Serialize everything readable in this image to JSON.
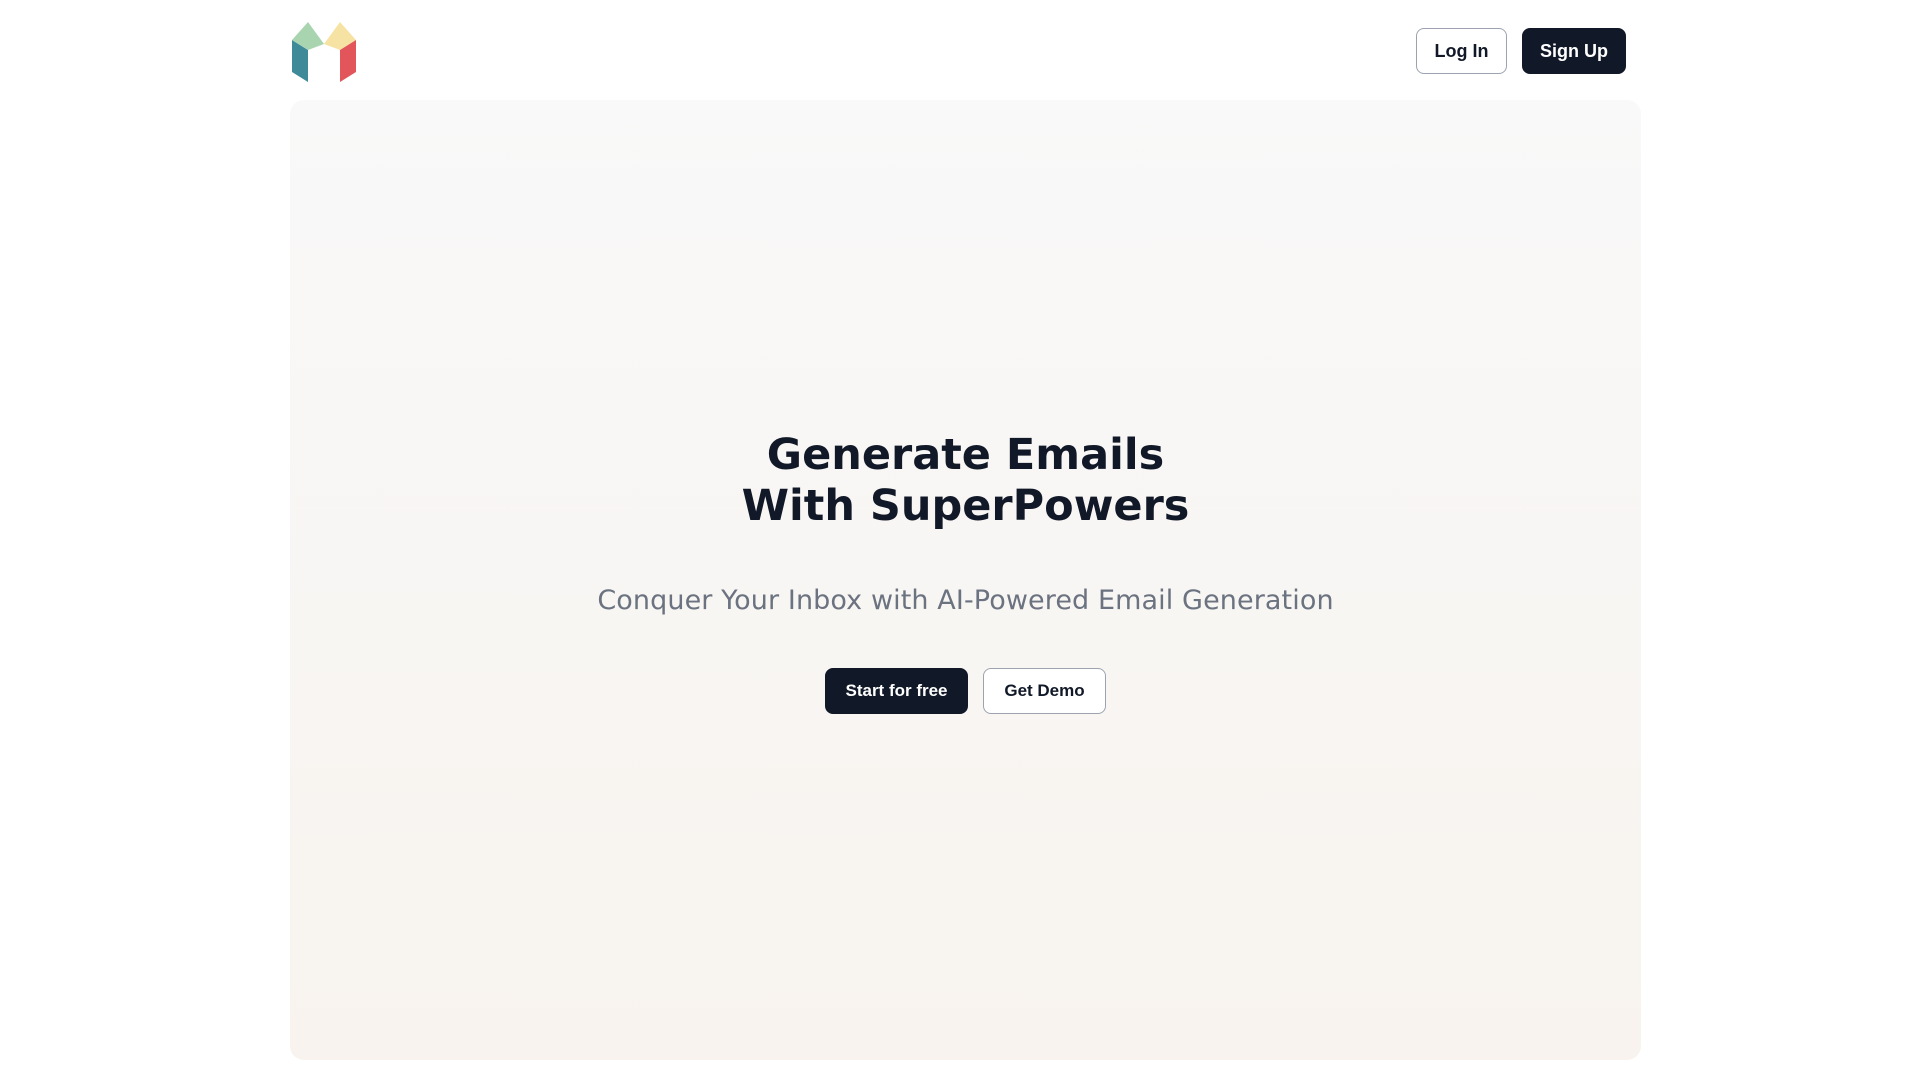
{
  "header": {
    "logo_alt": "M logo",
    "login_label": "Log In",
    "signup_label": "Sign Up"
  },
  "hero": {
    "title": "Generate Emails With SuperPowers",
    "subtitle": "Conquer Your Inbox with AI-Powered Email Generation",
    "primary_cta": "Start for free",
    "secondary_cta": "Get Demo"
  },
  "colors": {
    "primary_dark": "#111827",
    "subtitle_gray": "#6b7280",
    "logo_teal": "#3f8a99",
    "logo_green": "#a8d5b0",
    "logo_yellow": "#f6e3a4",
    "logo_red": "#e2555a"
  }
}
